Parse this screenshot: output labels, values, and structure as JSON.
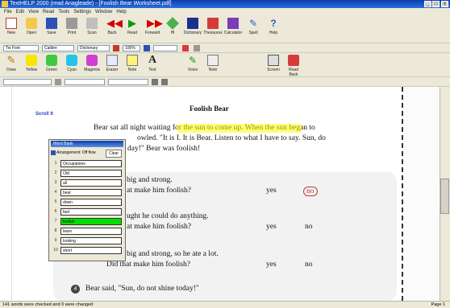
{
  "window": {
    "title": "TextHELP 2000 (read Anagleade) - [Foolish Bear Worksheet.pdf]",
    "controls": [
      "_",
      "□",
      "x"
    ]
  },
  "menubar": [
    "File",
    "Edit",
    "View",
    "Read",
    "Tools",
    "Settings",
    "Window",
    "Help"
  ],
  "toolbar1": [
    "New",
    "Open",
    "Save",
    "Print",
    "Scan",
    "Back",
    "Read",
    "Forward",
    "Hl",
    "Dictionary",
    "Thesaurus",
    "Calculator",
    "Spell",
    "Help"
  ],
  "toolbar2": {
    "font": "Tw Font",
    "font_size": "Calibre",
    "size2": "Dictionary",
    "size3": "100%"
  },
  "toolbar3": [
    "Draw",
    "Yellow",
    "Green",
    "Cyan",
    "Magenta",
    "Eraser",
    "Note",
    "Text",
    "Voice",
    "Note",
    "Screen",
    "Read Back"
  ],
  "document": {
    "title": "Foolish Bear",
    "margin_label": "Scroll It",
    "lines": [
      "Bear sat all night waiting for the sun to come up.  When the sun began to",
      "owled.  \"It is I.  It is Bear.  Listen to what I have to say.  Sun, do",
      "day!\"  Bear was foolish!",
      "big and strong.",
      "at make him foolish?",
      "yes",
      "no",
      "ught he could do anything.",
      "at make him foolish?",
      "yes",
      "no",
      "big and strong, so he ate a lot.",
      "Did that make him foolish?",
      "yes",
      "no",
      "Bear said, \"Sun, do not shine today!\""
    ],
    "highlight_color": "#ffff00",
    "bullet_number": "4"
  },
  "panel": {
    "title": "Word Bank",
    "filter_label": "Arrangement: Off flow",
    "button_label": "Clear",
    "items": [
      {
        "num": "1",
        "text": "Occupations"
      },
      {
        "num": "2",
        "text": "Old"
      },
      {
        "num": "3",
        "text": "all"
      },
      {
        "num": "4",
        "text": "bear"
      },
      {
        "num": "5",
        "text": "down"
      },
      {
        "num": "6",
        "text": "fast"
      },
      {
        "num": "7",
        "text": "foolish"
      },
      {
        "num": "8",
        "text": "learn"
      },
      {
        "num": "9",
        "text": "looking"
      },
      {
        "num": "10",
        "text": "short"
      }
    ],
    "selected_index": 6,
    "selected_color": "#00e000"
  },
  "status": {
    "left": "141 words were checked and 0 were changed",
    "right": "Page 1"
  }
}
